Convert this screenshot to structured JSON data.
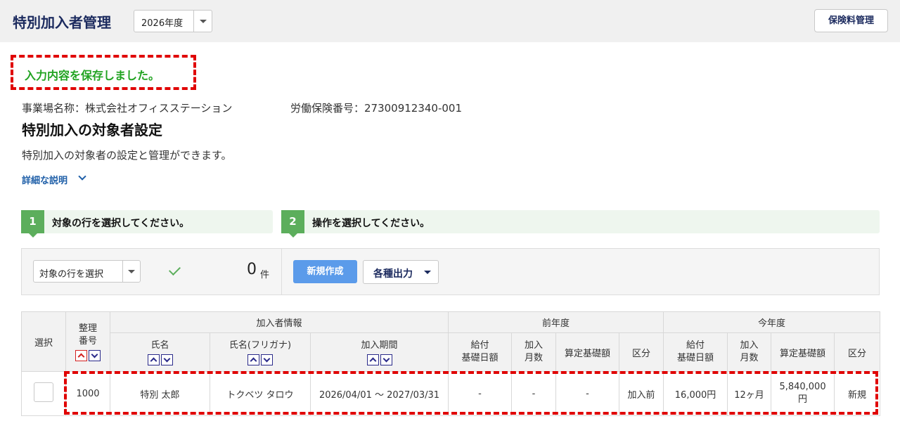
{
  "header": {
    "title": "特別加入者管理",
    "year_value": "2026年度",
    "premium_button": "保険料管理"
  },
  "notice": {
    "saved_message": "入力内容を保存しました。"
  },
  "info": {
    "office": "事業場名称：株式会社オフィスステーション",
    "insurance_number": "労働保険番号：27300912340-001"
  },
  "page": {
    "title": "特別加入の対象者設定",
    "description": "特別加入の対象者の設定と管理ができます。",
    "detail_link": "詳細な説明"
  },
  "steps": [
    {
      "number": "1",
      "text": "対象の行を選択してください。"
    },
    {
      "number": "2",
      "text": "操作を選択してください。"
    }
  ],
  "actions": {
    "row_select_value": "対象の行を選択",
    "selected_count": "0",
    "count_unit": "件",
    "new_button": "新規作成",
    "export_button": "各種出力"
  },
  "table": {
    "col_select": "選択",
    "col_number_line1": "整理",
    "col_number_line2": "番号",
    "group_subscriber": "加入者情報",
    "group_prev_year": "前年度",
    "group_this_year": "今年度",
    "col_name": "氏名",
    "col_kana": "氏名(フリガナ)",
    "col_period": "加入期間",
    "col_daily_base_line1": "給付",
    "col_daily_base_line2": "基礎日額",
    "col_months_line1": "加入",
    "col_months_line2": "月数",
    "col_calc_base": "算定基礎額",
    "col_category": "区分",
    "rows": [
      {
        "number": "1000",
        "name": "特別 太郎",
        "kana": "トクベツ タロウ",
        "period": "2026/04/01 ～ 2027/03/31",
        "prev_daily": "-",
        "prev_months": "-",
        "prev_calc": "-",
        "prev_category": "加入前",
        "cur_daily": "16,000円",
        "cur_months": "12ヶ月",
        "cur_calc_line1": "5,840,000",
        "cur_calc_line2": "円",
        "cur_category": "新規"
      }
    ]
  },
  "colors": {
    "brand_navy": "#1b2a5e",
    "success_green": "#21a321",
    "step_green": "#5cae5c",
    "primary_blue": "#5b9bea",
    "highlight_red": "#e00000",
    "link_blue": "#1f5fa8"
  }
}
